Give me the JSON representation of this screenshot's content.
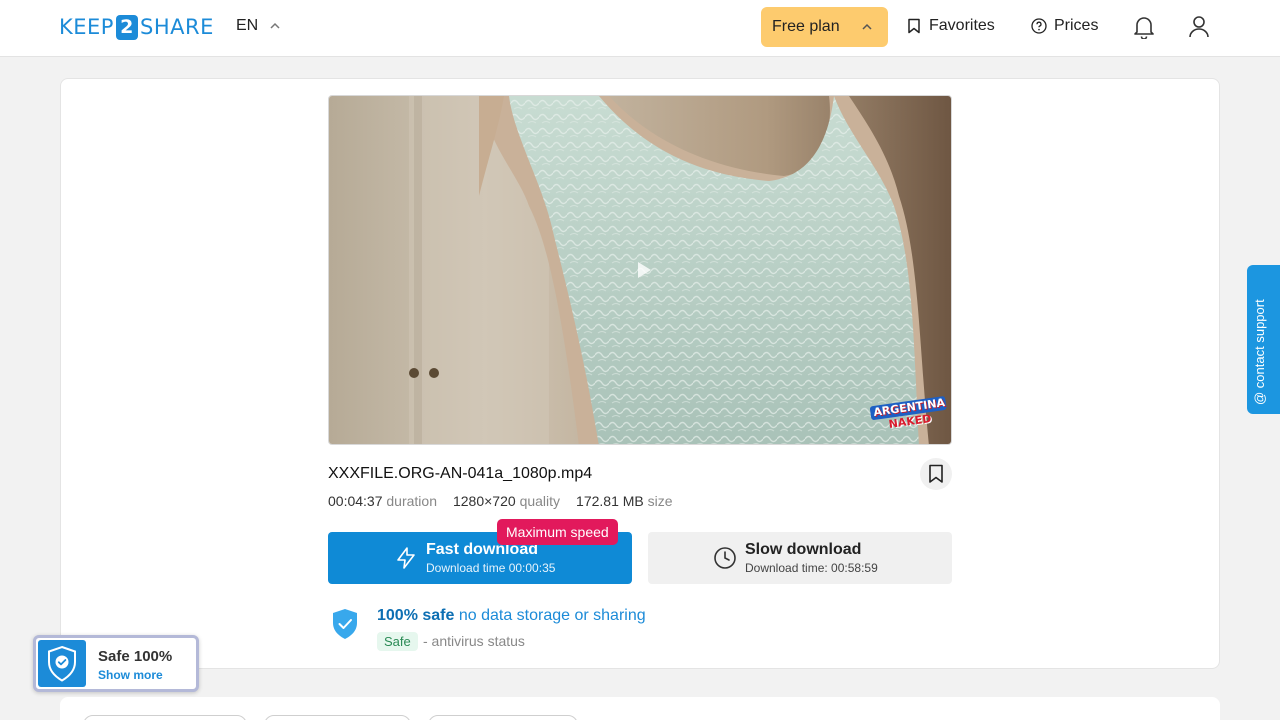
{
  "header": {
    "logo_left": "KEEP",
    "logo_mid": "2",
    "logo_right": "SHARE",
    "language": "EN",
    "plan_label": "Free plan",
    "favorites_label": "Favorites",
    "prices_label": "Prices"
  },
  "file": {
    "name": "XXXFILE.ORG-AN-041a_1080p.mp4",
    "duration": "00:04:37",
    "duration_label": "duration",
    "quality": "1280×720",
    "quality_label": "quality",
    "size": "172.81 MB",
    "size_label": "size",
    "watermark_top": "ARGENTINA",
    "watermark_bottom": "NAKED"
  },
  "download": {
    "badge": "Maximum speed",
    "fast_label": "Fast download",
    "fast_time": "Download time 00:00:35",
    "slow_label": "Slow download",
    "slow_time": "Download time: 00:58:59"
  },
  "safety": {
    "strong": "100% safe",
    "rest": "no data storage or sharing",
    "chip": "Safe",
    "status": "- antivirus status"
  },
  "widget": {
    "title": "Safe 100%",
    "link": "Show more"
  },
  "support_label": "@ contact support",
  "colors": {
    "accent": "#1c8bd8",
    "fast_button": "#0f8ad6",
    "plan_button": "#fdcb6e",
    "badge": "#e2195c"
  }
}
